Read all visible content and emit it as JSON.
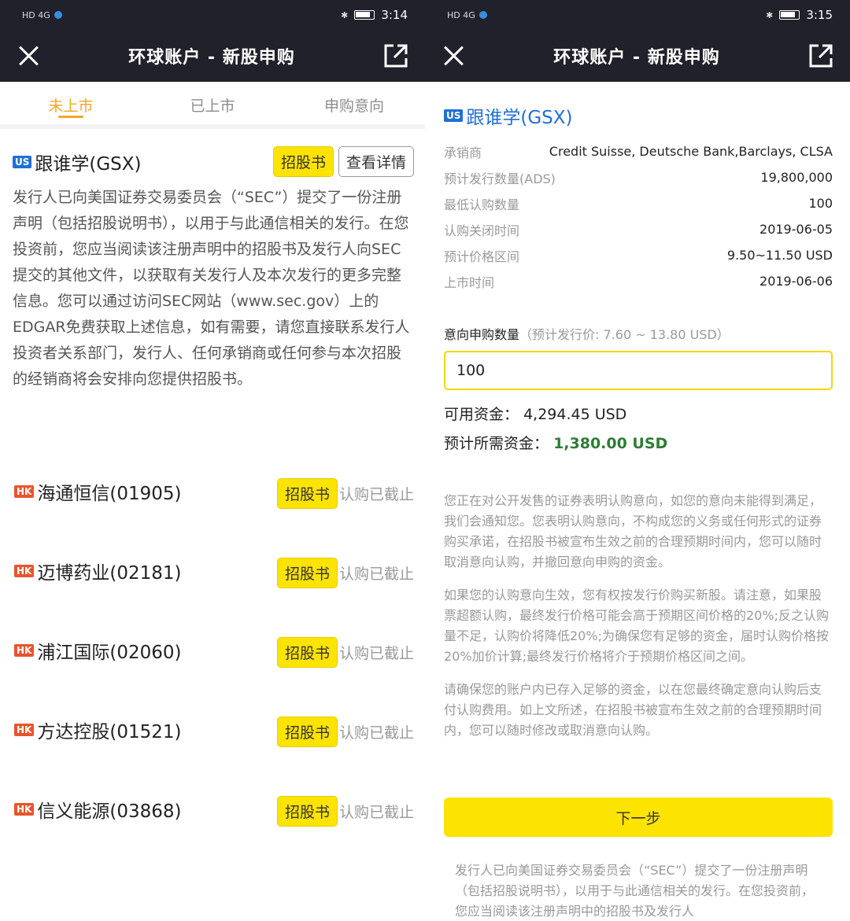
{
  "left": {
    "status": {
      "time": "3:14",
      "left_icons": "HD 4G"
    },
    "nav": {
      "title": "环球账户 - 新股申购"
    },
    "tabs": [
      {
        "label": "未上市",
        "active": true
      },
      {
        "label": "已上市",
        "active": false
      },
      {
        "label": "申购意向",
        "active": false
      }
    ],
    "featured": {
      "badge": "US",
      "name": "跟谁学(GSX)",
      "prospectus_btn": "招股书",
      "details_btn": "查看详情",
      "disclaimer": "发行人已向美国证券交易委员会（“SEC”）提交了一份注册声明（包括招股说明书），以用于与此通信相关的发行。在您投资前，您应当阅读该注册声明中的招股书及发行人向SEC提交的其他文件，以获取有关发行人及本次发行的更多完整信息。您可以通过访问SEC网站（www.sec.gov）上的EDGAR免费获取上述信息，如有需要，请您直接联系发行人投资者关系部门，发行人、任何承销商或任何参与本次招股的经销商将会安排向您提供招股书。"
    },
    "hk_stocks": [
      {
        "badge": "HK",
        "name": "海通恒信(01905)",
        "prospectus_btn": "招股书",
        "status": "认购已截止"
      },
      {
        "badge": "HK",
        "name": "迈博药业(02181)",
        "prospectus_btn": "招股书",
        "status": "认购已截止"
      },
      {
        "badge": "HK",
        "name": "浦江国际(02060)",
        "prospectus_btn": "招股书",
        "status": "认购已截止"
      },
      {
        "badge": "HK",
        "name": "方达控股(01521)",
        "prospectus_btn": "招股书",
        "status": "认购已截止"
      },
      {
        "badge": "HK",
        "name": "信义能源(03868)",
        "prospectus_btn": "招股书",
        "status": "认购已截止"
      }
    ]
  },
  "right": {
    "status": {
      "time": "3:15",
      "left_icons": "HD 4G"
    },
    "nav": {
      "title": "环球账户 - 新股申购"
    },
    "stock": {
      "badge": "US",
      "name": "跟谁学(GSX)"
    },
    "info": [
      {
        "key": "承销商",
        "value": "Credit Suisse, Deutsche Bank,Barclays, CLSA"
      },
      {
        "key": "预计发行数量(ADS)",
        "value": "19,800,000"
      },
      {
        "key": "最低认购数量",
        "value": "100"
      },
      {
        "key": "认购关闭时间",
        "value": "2019-06-05"
      },
      {
        "key": "预计价格区间",
        "value": "9.50~11.50 USD"
      },
      {
        "key": "上市时间",
        "value": "2019-06-06"
      }
    ],
    "intent": {
      "label": "意向申购数量",
      "hint": "（预计发行价: 7.60 ~ 13.80 USD）",
      "quantity": "100"
    },
    "funds": {
      "available_label": "可用资金：",
      "available_value": "4,294.45 USD",
      "required_label": "预计所需资金：",
      "required_value": "1,380.00 USD"
    },
    "paragraphs": [
      "您正在对公开发售的证券表明认购意向，如您的意向未能得到满足，我们会通知您。您表明认购意向，不构成您的义务或任何形式的证券购买承诺，在招股书被宣布生效之前的合理预期时间内，您可以随时取消意向认购，并撤回意向申购的资金。",
      "如果您的认购意向生效，您有权按发行价购买新股。请注意，如果股票超额认购，最终发行价格可能会高于预期区间价格的20%;反之认购量不足，认购价将降低20%;为确保您有足够的资金，届时认购价格按20%加价计算;最终发行价格将介于预期价格区间之间。",
      "请确保您的账户内已存入足够的资金，以在您最终确定意向认购后支付认购费用。如上文所述，在招股书被宣布生效之前的合理预期时间内，您可以随时修改或取消意向认购。"
    ],
    "next_btn": "下一步",
    "bottom_disclaimer": "发行人已向美国证券交易委员会（“SEC”）提交了一份注册声明（包括招股说明书），以用于与此通信相关的发行。在您投资前，您应当阅读该注册声明中的招股书及发行人"
  }
}
